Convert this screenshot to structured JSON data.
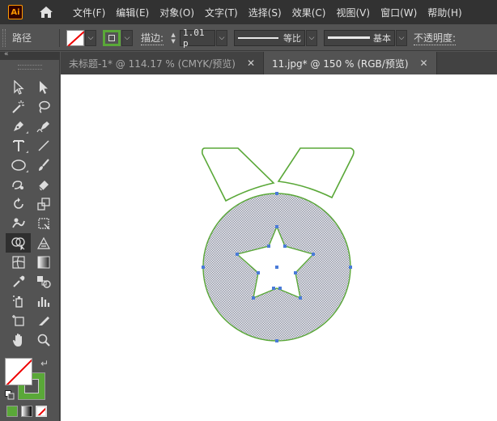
{
  "app": {
    "logo_text": "Ai"
  },
  "menu": {
    "items": [
      "文件(F)",
      "编辑(E)",
      "对象(O)",
      "文字(T)",
      "选择(S)",
      "效果(C)",
      "视图(V)",
      "窗口(W)",
      "帮助(H)"
    ]
  },
  "controlbar": {
    "selection_label": "路径",
    "stroke_label": "描边:",
    "stroke_weight": "1.01 p",
    "profile_label": "等比",
    "brush_label": "基本",
    "opacity_label": "不透明度:"
  },
  "tabs": [
    {
      "label": "未标题-1* @ 114.17 % (CMYK/预览)",
      "active": false
    },
    {
      "label": "11.jpg* @ 150 % (RGB/预览)",
      "active": true
    }
  ],
  "colors": {
    "stroke_green": "#5aa838",
    "selection_blue": "#4a7bd8",
    "fill_none_red": "#e00000",
    "chrome_dark": "#323232",
    "panel": "#535353"
  },
  "tools": [
    [
      "selection-tool",
      "direct-selection-tool"
    ],
    [
      "magic-wand-tool",
      "lasso-tool"
    ],
    [
      "pen-tool",
      "curvature-tool"
    ],
    [
      "type-tool",
      "line-segment-tool"
    ],
    [
      "ellipse-tool",
      "paintbrush-tool"
    ],
    [
      "shaper-tool",
      "eraser-tool"
    ],
    [
      "rotate-tool",
      "scale-tool"
    ],
    [
      "warp-tool",
      "free-transform-tool"
    ],
    [
      "shape-builder-tool",
      "perspective-grid-tool"
    ],
    [
      "mesh-tool",
      "gradient-tool"
    ],
    [
      "eyedropper-tool",
      "blend-tool"
    ],
    [
      "symbol-sprayer-tool",
      "column-graph-tool"
    ],
    [
      "artboard-tool",
      "slice-tool"
    ],
    [
      "hand-tool",
      "zoom-tool"
    ]
  ]
}
